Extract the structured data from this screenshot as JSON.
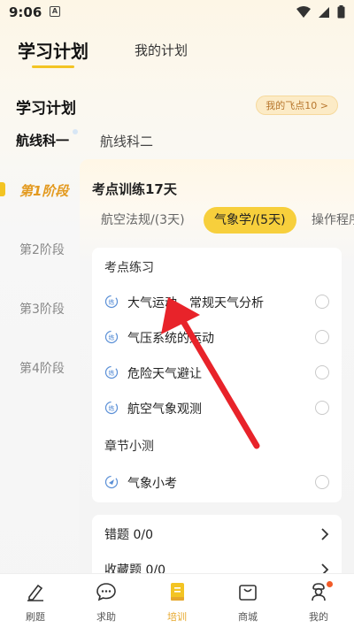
{
  "status": {
    "time": "9:06",
    "notif_glyph": "A"
  },
  "top_tabs": {
    "active": "学习计划",
    "inactive": "我的计划"
  },
  "plan": {
    "title": "学习计划",
    "points_badge": "我的飞点10 >",
    "courses": [
      "航线科一",
      "航线科二"
    ]
  },
  "stages": [
    "第1阶段",
    "第2阶段",
    "第3阶段",
    "第4阶段"
  ],
  "panel": {
    "title": "考点训练17天",
    "subjects": [
      "航空法规/(3天)",
      "气象学/(5天)",
      "操作程序"
    ],
    "practice_heading": "考点练习",
    "practice_items": [
      "大气运动、常规天气分析",
      "气压系统的运动",
      "危险天气避让",
      "航空气象观测"
    ],
    "quiz_heading": "章节小测",
    "quiz_items": [
      "气象小考"
    ],
    "links": [
      "错题 0/0",
      "收藏题 0/0"
    ]
  },
  "tabbar": [
    "刷题",
    "求助",
    "培训",
    "商城",
    "我的"
  ],
  "colors": {
    "accent": "#f3c423",
    "active_stage": "#e39a20",
    "arrow": "#e8232a"
  }
}
